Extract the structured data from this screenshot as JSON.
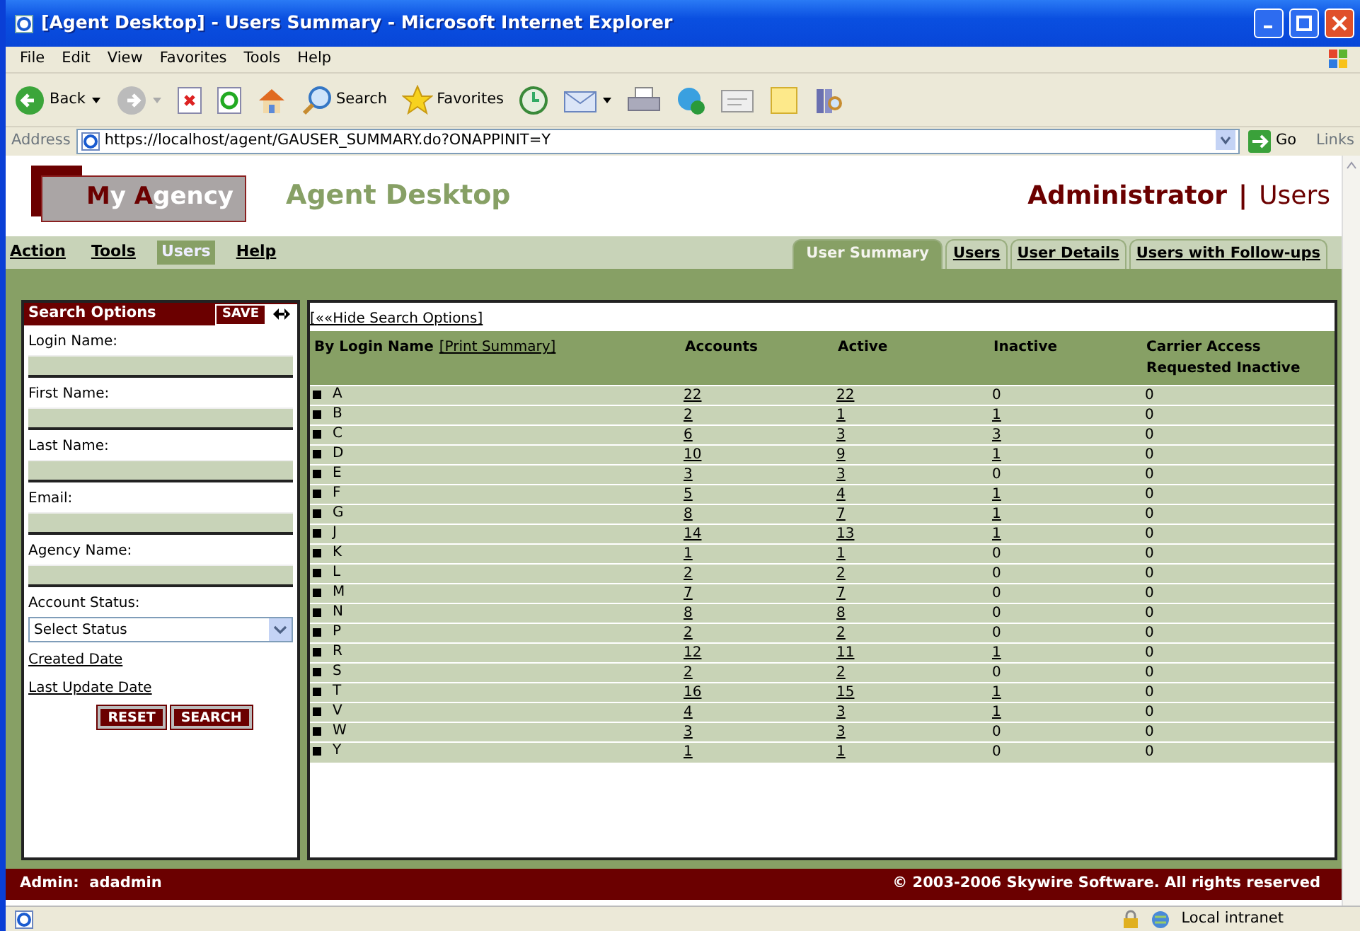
{
  "window": {
    "title": "[Agent Desktop] - Users Summary - Microsoft Internet Explorer"
  },
  "menu_bar": [
    "File",
    "Edit",
    "View",
    "Favorites",
    "Tools",
    "Help"
  ],
  "toolbar": {
    "back": "Back",
    "search": "Search",
    "favorites": "Favorites"
  },
  "address_bar": {
    "label": "Address",
    "url": "https://localhost/agent/GAUSER_SUMMARY.do?ONAPPINIT=Y",
    "go": "Go",
    "links": "Links"
  },
  "header": {
    "logo": [
      {
        "text": "M",
        "accent": true
      },
      {
        "text": "y ",
        "accent": false
      },
      {
        "text": "A",
        "accent": true
      },
      {
        "text": "gency",
        "accent": false
      }
    ],
    "app": "Agent Desktop",
    "role": "Administrator",
    "separator": "|",
    "section": "Users"
  },
  "nav": {
    "menu": [
      {
        "label": "Action",
        "selected": false
      },
      {
        "label": "Tools",
        "selected": false
      },
      {
        "label": "Users",
        "selected": true
      },
      {
        "label": "Help",
        "selected": false
      }
    ],
    "tabs": [
      {
        "label": "User Summary",
        "selected": true
      },
      {
        "label": "Users",
        "selected": false
      },
      {
        "label": "User Details",
        "selected": false
      },
      {
        "label": "Users with Follow-ups",
        "selected": false
      }
    ]
  },
  "search_panel": {
    "title": "Search Options",
    "save": "SAVE",
    "fields": [
      {
        "label": "Login Name:",
        "kind": "text"
      },
      {
        "label": "First Name:",
        "kind": "text"
      },
      {
        "label": "Last Name:",
        "kind": "text"
      },
      {
        "label": "Email:",
        "kind": "text"
      },
      {
        "label": "Agency Name:",
        "kind": "text"
      },
      {
        "label": "Account Status:",
        "kind": "select",
        "value": "Select Status"
      }
    ],
    "links": [
      "Created Date",
      "Last Update Date"
    ],
    "buttons": [
      "RESET",
      "SEARCH"
    ]
  },
  "summary": {
    "toggle": "[««Hide Search Options]",
    "print_link": "[Print Summary]",
    "columns": [
      "By Login Name",
      "Accounts",
      "Active",
      "Inactive",
      "Carrier Access Requested Inactive"
    ],
    "rows": [
      {
        "name": "A",
        "accounts": "22",
        "active": "22",
        "inactive": "0",
        "inactive_linked": false,
        "carrier": "0"
      },
      {
        "name": "B",
        "accounts": "2",
        "active": "1",
        "inactive": "1",
        "inactive_linked": true,
        "carrier": "0"
      },
      {
        "name": "C",
        "accounts": "6",
        "active": "3",
        "inactive": "3",
        "inactive_linked": true,
        "carrier": "0"
      },
      {
        "name": "D",
        "accounts": "10",
        "active": "9",
        "inactive": "1",
        "inactive_linked": true,
        "carrier": "0"
      },
      {
        "name": "E",
        "accounts": "3",
        "active": "3",
        "inactive": "0",
        "inactive_linked": false,
        "carrier": "0"
      },
      {
        "name": "F",
        "accounts": "5",
        "active": "4",
        "inactive": "1",
        "inactive_linked": true,
        "carrier": "0"
      },
      {
        "name": "G",
        "accounts": "8",
        "active": "7",
        "inactive": "1",
        "inactive_linked": true,
        "carrier": "0"
      },
      {
        "name": "J",
        "accounts": "14",
        "active": "13",
        "inactive": "1",
        "inactive_linked": true,
        "carrier": "0"
      },
      {
        "name": "K",
        "accounts": "1",
        "active": "1",
        "inactive": "0",
        "inactive_linked": false,
        "carrier": "0"
      },
      {
        "name": "L",
        "accounts": "2",
        "active": "2",
        "inactive": "0",
        "inactive_linked": false,
        "carrier": "0"
      },
      {
        "name": "M",
        "accounts": "7",
        "active": "7",
        "inactive": "0",
        "inactive_linked": false,
        "carrier": "0"
      },
      {
        "name": "N",
        "accounts": "8",
        "active": "8",
        "inactive": "0",
        "inactive_linked": false,
        "carrier": "0"
      },
      {
        "name": "P",
        "accounts": "2",
        "active": "2",
        "inactive": "0",
        "inactive_linked": false,
        "carrier": "0"
      },
      {
        "name": "R",
        "accounts": "12",
        "active": "11",
        "inactive": "1",
        "inactive_linked": true,
        "carrier": "0"
      },
      {
        "name": "S",
        "accounts": "2",
        "active": "2",
        "inactive": "0",
        "inactive_linked": false,
        "carrier": "0"
      },
      {
        "name": "T",
        "accounts": "16",
        "active": "15",
        "inactive": "1",
        "inactive_linked": true,
        "carrier": "0"
      },
      {
        "name": "V",
        "accounts": "4",
        "active": "3",
        "inactive": "1",
        "inactive_linked": true,
        "carrier": "0"
      },
      {
        "name": "W",
        "accounts": "3",
        "active": "3",
        "inactive": "0",
        "inactive_linked": false,
        "carrier": "0"
      },
      {
        "name": "Y",
        "accounts": "1",
        "active": "1",
        "inactive": "0",
        "inactive_linked": false,
        "carrier": "0"
      }
    ]
  },
  "footer": {
    "user": "Admin:  adadmin",
    "copyright": "© 2003-2006 Skywire Software. All rights reserved"
  },
  "status_bar": {
    "zone": "Local intranet"
  }
}
